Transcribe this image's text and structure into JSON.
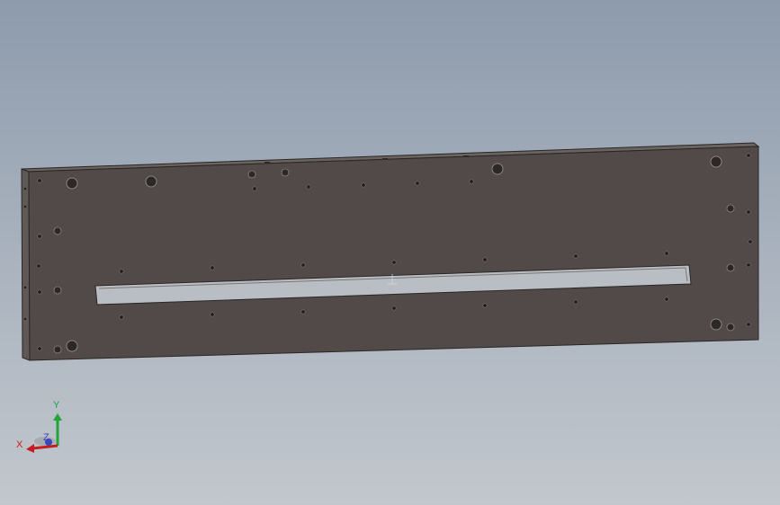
{
  "app": {
    "type": "cad-3d-viewport",
    "background_top": "#8e9bad",
    "background_bottom": "#c2c7cd"
  },
  "model": {
    "name": "",
    "face_color": "#514a48",
    "edge_color": "#2a2624",
    "top_face_color": "#6a6461",
    "slot_color": "#b9bec4",
    "hole_color": "#2c2826"
  },
  "triad": {
    "x_label": "X",
    "y_label": "Y",
    "z_label": "Z",
    "x_color": "#c41e1e",
    "y_color": "#1fa63a",
    "z_color": "#3b46b8"
  }
}
